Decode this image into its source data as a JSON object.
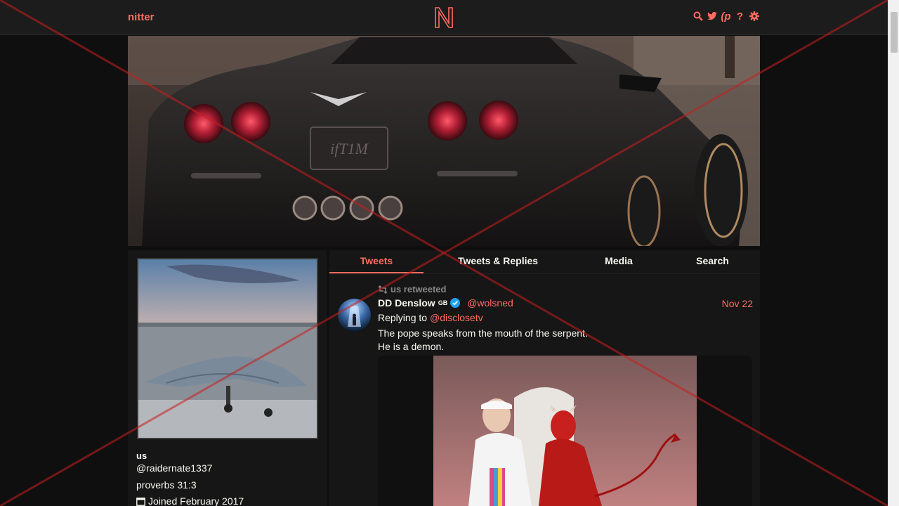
{
  "navbar": {
    "brand": "nitter",
    "icons": [
      "search-icon",
      "twitter-bird-icon",
      "rss-icon",
      "help-icon",
      "gear-icon"
    ],
    "rss_glyph": "(p",
    "help_glyph": "?"
  },
  "profile": {
    "fullname": "us",
    "username": "@raidernate1337",
    "bio": "proverbs 31:3",
    "joined": "Joined February 2017"
  },
  "tabs": [
    {
      "label": "Tweets",
      "active": true
    },
    {
      "label": "Tweets & Replies",
      "active": false
    },
    {
      "label": "Media",
      "active": false
    },
    {
      "label": "Search",
      "active": false
    }
  ],
  "tweet": {
    "retweet_header": "us retweeted",
    "fullname": "DD Denslow",
    "flag": "GB",
    "username": "@wolsned",
    "date": "Nov 22",
    "replying_prefix": "Replying to",
    "replying_to": "@disclosetv",
    "text": "The pope speaks from the mouth of the serpent.\nHe is a demon."
  },
  "colors": {
    "accent": "#ff6c60",
    "background": "#0f0f0f",
    "panel": "#161616",
    "navbar": "#1c1c1c",
    "text": "#f8f8f2",
    "muted": "#888889",
    "verified": "#1da1f2",
    "overlay": "#c81e1e"
  }
}
